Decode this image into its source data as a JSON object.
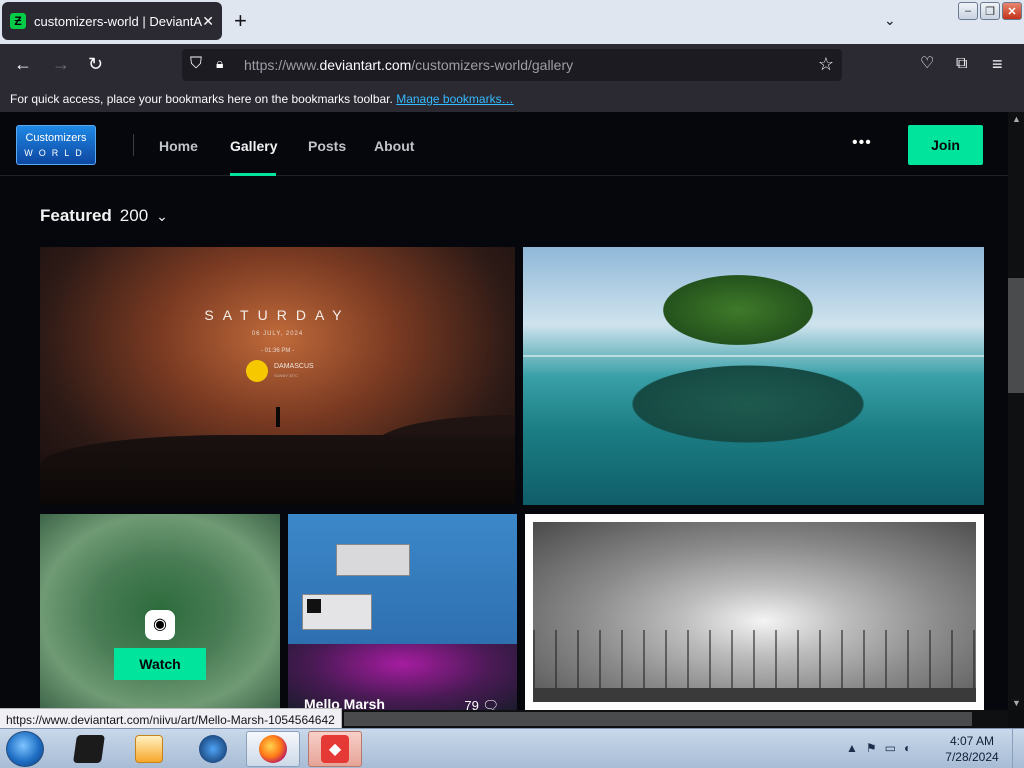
{
  "browser": {
    "tab": {
      "title": "customizers-world | DeviantArt",
      "favicon": "deviantart-logo-icon"
    },
    "url": {
      "prefix": "https://www.",
      "domain": "deviantart.com",
      "path": "/customizers-world/gallery"
    },
    "bookmarks_bar": {
      "message": "For quick access, place your bookmarks here on the bookmarks toolbar.",
      "link": "Manage bookmarks…"
    },
    "status_link": "https://www.deviantart.com/niivu/art/Mello-Marsh-1054564642"
  },
  "site": {
    "logo": {
      "line1": "Customizers",
      "line2": "WORLD"
    },
    "nav": [
      {
        "label": "Home",
        "active": false
      },
      {
        "label": "Gallery",
        "active": true
      },
      {
        "label": "Posts",
        "active": false
      },
      {
        "label": "About",
        "active": false
      }
    ],
    "more_label": "•••",
    "join_label": "Join",
    "accent": "#00e59b"
  },
  "gallery": {
    "section_label": "Featured",
    "section_count": "200",
    "cards": [
      {
        "id": "saturday",
        "overlay": {
          "day": "SATURDAY",
          "date": "06 JULY, 2024",
          "time": "- 01:36 PM -",
          "city": "DAMASCUS",
          "weather": "SUNNY 33°C"
        }
      },
      {
        "id": "turtle-island"
      },
      {
        "id": "blurred-green",
        "watch_label": "Watch"
      },
      {
        "id": "mello-marsh",
        "title": "Mello Marsh",
        "comments": "79"
      },
      {
        "id": "bw-trees"
      }
    ]
  },
  "taskbar": {
    "clock_time": "4:07 AM",
    "clock_date": "7/28/2024"
  }
}
